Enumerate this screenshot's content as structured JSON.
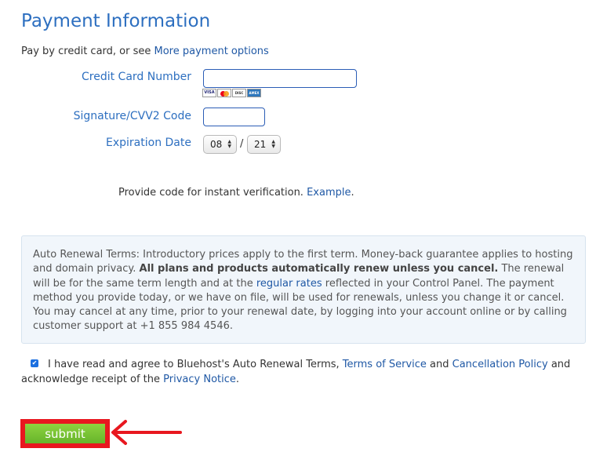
{
  "title": "Payment Information",
  "pay_by": {
    "text": "Pay by credit card, or see ",
    "link": "More payment options"
  },
  "form": {
    "card_number_label": "Credit Card Number",
    "card_number_value": "",
    "card_logos": [
      "VISA",
      "MC",
      "DISCOVER",
      "AMEX"
    ],
    "cvv_label": "Signature/CVV2 Code",
    "cvv_value": "",
    "expiration_label": "Expiration Date",
    "exp_month": "08",
    "exp_separator": "/",
    "exp_year": "21"
  },
  "verification": {
    "text": "Provide code for instant verification. ",
    "link": "Example",
    "period": "."
  },
  "renewal_terms": {
    "intro": "Auto Renewal Terms: Introductory prices apply to the first term. Money-back guarantee applies to hosting and domain privacy. ",
    "bold": "All plans and products automatically renew unless you cancel.",
    "middle": " The renewal will be for the same term length and at the ",
    "rates_link": "regular rates",
    "rest": " reflected in your Control Panel. The payment method you provide today, or we have on file, will be used for renewals, unless you change it or cancel. You may cancel at any time, prior to your renewal date, by logging into your account online or by calling customer support at +1 855 984 4546."
  },
  "agreement": {
    "checked": true,
    "text1": "I have read and agree to Bluehost's Auto Renewal Terms, ",
    "terms_link": "Terms of Service",
    "and": " and ",
    "cancel_link": "Cancellation Policy",
    "text2": " and acknowledge receipt of the ",
    "privacy_link": "Privacy Notice",
    "period": "."
  },
  "submit_label": "submit",
  "colors": {
    "title": "#2d6fc0",
    "link": "#1f58a5",
    "submit": "#7cc437",
    "highlight": "#e8171f",
    "terms_bg": "#f1f6fb"
  }
}
